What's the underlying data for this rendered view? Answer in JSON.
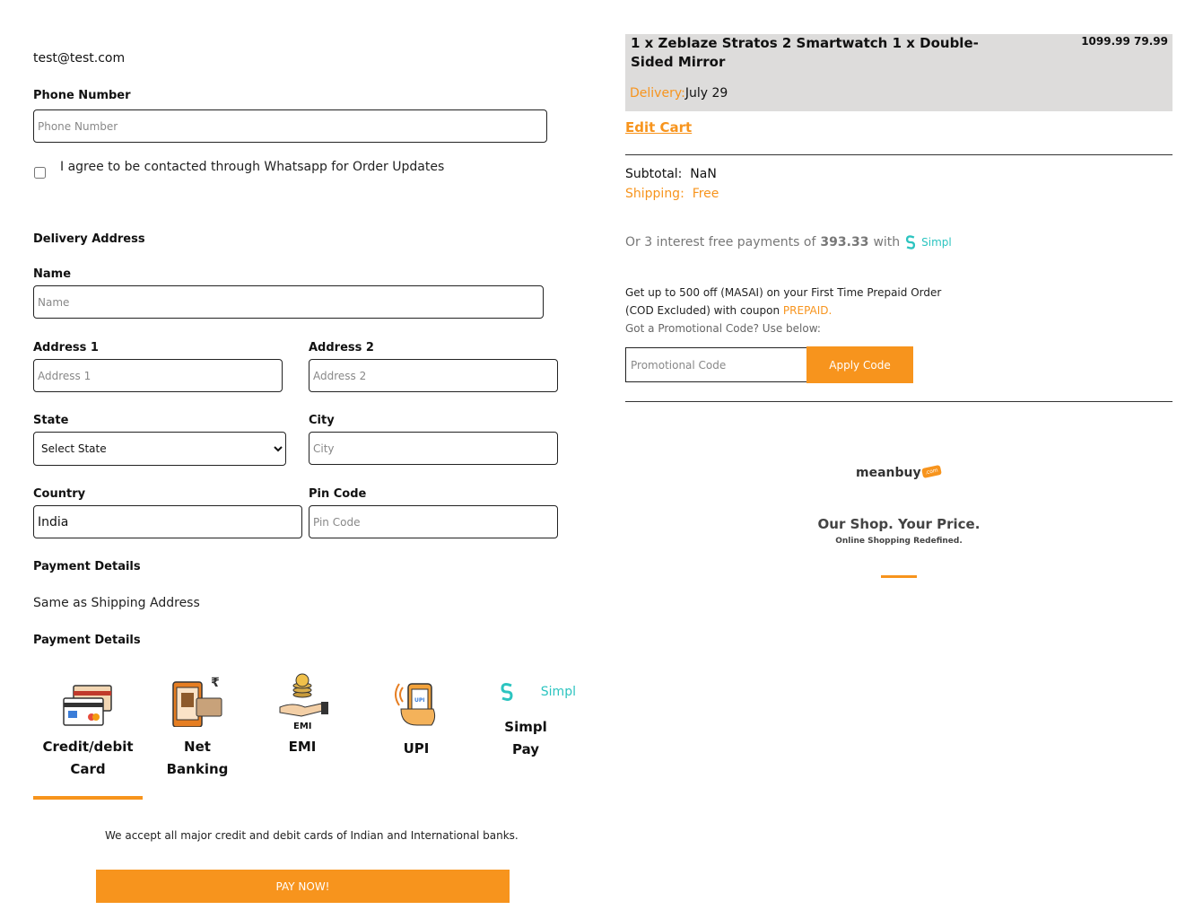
{
  "contact": {
    "email": "test@test.com",
    "phone_label": "Phone Number",
    "phone_placeholder": "Phone Number",
    "whatsapp_text": "I agree to be contacted through Whatsapp for Order Updates"
  },
  "delivery": {
    "heading": "Delivery Address",
    "name_label": "Name",
    "name_placeholder": "Name",
    "address1_label": "Address 1",
    "address1_placeholder": "Address 1",
    "address2_label": "Address 2",
    "address2_placeholder": "Address 2",
    "state_label": "State",
    "state_selected": "Select State",
    "city_label": "City",
    "city_placeholder": "City",
    "country_label": "Country",
    "country_value": "India",
    "pin_label": "Pin Code",
    "pin_placeholder": "Pin Code"
  },
  "payment": {
    "heading1": "Payment Details",
    "same_as_shipping": "Same as Shipping Address",
    "heading2": "Payment Details",
    "methods": [
      {
        "line1": "Credit/debit",
        "line2": "Card",
        "icon": "credit-card-icon"
      },
      {
        "line1": "Net",
        "line2": "Banking",
        "icon": "net-banking-icon"
      },
      {
        "line1": "EMI",
        "line2": "",
        "icon": "emi-icon",
        "icon_caption": "EMI"
      },
      {
        "line1": "UPI",
        "line2": "",
        "icon": "upi-icon"
      },
      {
        "line1": "Simpl",
        "line2": "Pay",
        "icon": "simpl-logo-icon",
        "icon_caption": "Simpl"
      }
    ],
    "accept_note": "We accept all major credit and debit cards of Indian and International banks.",
    "pay_button": "PAY NOW!"
  },
  "cart": {
    "items_text": "1 x Zeblaze Stratos 2 Smartwatch 1 x Double-Sided Mirror",
    "prices": "1099.99 79.99",
    "delivery_label": "Delivery:",
    "delivery_date": "July 29",
    "edit_cart": "Edit Cart",
    "subtotal_label": "Subtotal:",
    "subtotal_value": "NaN",
    "shipping_label": "Shipping:",
    "shipping_value": "Free",
    "simpl_prefix": "Or 3 interest free payments of",
    "simpl_amount": "393.33",
    "simpl_with": "with",
    "simpl_brand": "Simpl",
    "promo_line1": "Get up to 500 off (MASAI) on your First Time Prepaid Order",
    "promo_line2a": "(COD Excluded) with coupon",
    "promo_coupon": "PREPAID.",
    "promo_question": "Got a Promotional Code? Use below:",
    "promo_placeholder": "Promotional Code",
    "apply_button": "Apply Code"
  },
  "brand": {
    "logo_text": "meanbuy",
    "logo_badge": ".com",
    "tagline": "Our Shop. Your Price.",
    "subtagline": "Online Shopping Redefined."
  },
  "colors": {
    "accent": "#f7941d",
    "summary_bg": "#dddcdb",
    "simpl_teal": "#2cc4c0"
  }
}
